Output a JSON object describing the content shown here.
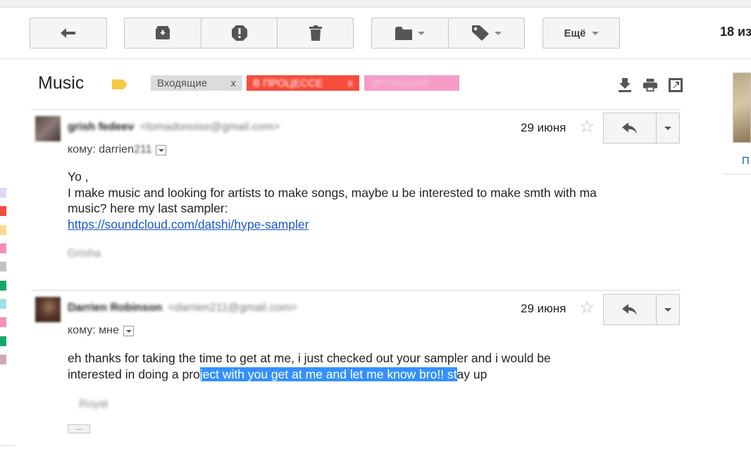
{
  "toolbar": {
    "more_label": "Ещё",
    "page_count": "18 из"
  },
  "thread": {
    "subject": "Music",
    "labels": [
      {
        "text": "Входящие",
        "remove": "x",
        "color": "#dcdcdc"
      },
      {
        "text": "В ПРОЦЕССЕ",
        "remove": "x",
        "color": "#f54c3c"
      },
      {
        "text": "ЗРУЛЬШИЙ",
        "color": "#f59cc6"
      }
    ]
  },
  "messages": [
    {
      "sender_name": "grish fedeev",
      "sender_email": "<lomadonoise@gmail.com>",
      "date": "29 июня",
      "to_prefix": "кому:",
      "to_visible": "darrien",
      "to_blurred": "211",
      "body_lines": [
        "Yo ,",
        "I make music and looking for artists to make songs, maybe u be interested to make smth with ma",
        "music? here my last sampler:"
      ],
      "link": "https://soundcloud.com/datshi/hype-sampler",
      "signature": "Grisha"
    },
    {
      "sender_name": "Darrien Robinson",
      "sender_email": "<darrien211@gmail.com>",
      "date": "29 июня",
      "to_prefix": "кому:",
      "to_visible": "мне",
      "body_line1": "eh thanks for taking the time to get at me, i just checked out your sampler and i would be",
      "body_line2_before": "interested in doing a pro",
      "body_line2_selected": "ject with you get at me and let me know bro!! st",
      "body_line2_after": "ay up",
      "signature": "Royal",
      "ellipsis": "..."
    }
  ],
  "right_panel": {
    "link": "П"
  },
  "colors": {
    "selection": "#3390ff",
    "link": "#1a56c9",
    "label_progress": "#f54c3c",
    "label_pink": "#f59cc6",
    "importance": "#f5c842"
  },
  "icons": [
    "back-arrow-icon",
    "archive-icon",
    "spam-icon",
    "trash-icon",
    "folder-icon",
    "tag-icon",
    "download-icon",
    "print-icon",
    "new-window-icon",
    "star-icon",
    "reply-icon"
  ]
}
